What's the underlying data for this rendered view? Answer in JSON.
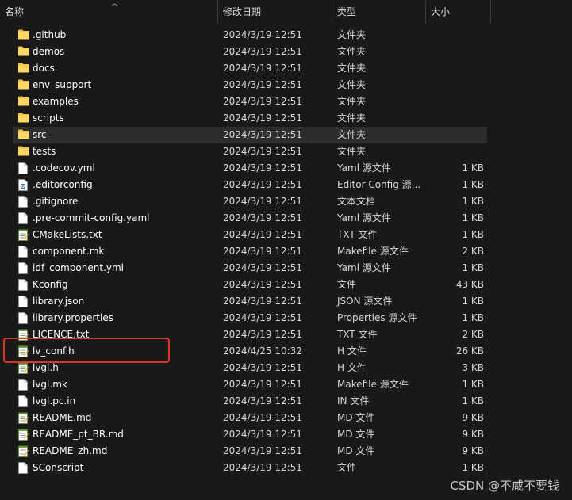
{
  "columns": {
    "name": "名称",
    "date": "修改日期",
    "type": "类型",
    "size": "大小"
  },
  "files": [
    {
      "name": ".github",
      "date": "2024/3/19 12:51",
      "type": "文件夹",
      "size": "",
      "icon": "folder-icon"
    },
    {
      "name": "demos",
      "date": "2024/3/19 12:51",
      "type": "文件夹",
      "size": "",
      "icon": "folder-icon"
    },
    {
      "name": "docs",
      "date": "2024/3/19 12:51",
      "type": "文件夹",
      "size": "",
      "icon": "folder-icon"
    },
    {
      "name": "env_support",
      "date": "2024/3/19 12:51",
      "type": "文件夹",
      "size": "",
      "icon": "folder-icon"
    },
    {
      "name": "examples",
      "date": "2024/3/19 12:51",
      "type": "文件夹",
      "size": "",
      "icon": "folder-icon"
    },
    {
      "name": "scripts",
      "date": "2024/3/19 12:51",
      "type": "文件夹",
      "size": "",
      "icon": "folder-icon"
    },
    {
      "name": "src",
      "date": "2024/3/19 12:51",
      "type": "文件夹",
      "size": "",
      "icon": "folder-icon"
    },
    {
      "name": "tests",
      "date": "2024/3/19 12:51",
      "type": "文件夹",
      "size": "",
      "icon": "folder-icon"
    },
    {
      "name": ".codecov.yml",
      "date": "2024/3/19 12:51",
      "type": "Yaml 源文件",
      "size": "1 KB",
      "icon": "file-icon"
    },
    {
      "name": ".editorconfig",
      "date": "2024/3/19 12:51",
      "type": "Editor Config 源...",
      "size": "1 KB",
      "icon": "config-file-icon"
    },
    {
      "name": ".gitignore",
      "date": "2024/3/19 12:51",
      "type": "文本文档",
      "size": "1 KB",
      "icon": "file-icon"
    },
    {
      "name": ".pre-commit-config.yaml",
      "date": "2024/3/19 12:51",
      "type": "Yaml 源文件",
      "size": "1 KB",
      "icon": "file-icon"
    },
    {
      "name": "CMakeLists.txt",
      "date": "2024/3/19 12:51",
      "type": "TXT 文件",
      "size": "1 KB",
      "icon": "notepad-file-icon"
    },
    {
      "name": "component.mk",
      "date": "2024/3/19 12:51",
      "type": "Makefile 源文件",
      "size": "2 KB",
      "icon": "file-icon"
    },
    {
      "name": "idf_component.yml",
      "date": "2024/3/19 12:51",
      "type": "Yaml 源文件",
      "size": "1 KB",
      "icon": "file-icon"
    },
    {
      "name": "Kconfig",
      "date": "2024/3/19 12:51",
      "type": "文件",
      "size": "43 KB",
      "icon": "file-icon"
    },
    {
      "name": "library.json",
      "date": "2024/3/19 12:51",
      "type": "JSON 源文件",
      "size": "1 KB",
      "icon": "file-icon"
    },
    {
      "name": "library.properties",
      "date": "2024/3/19 12:51",
      "type": "Properties 源文件",
      "size": "1 KB",
      "icon": "file-icon"
    },
    {
      "name": "LICENCE.txt",
      "date": "2024/3/19 12:51",
      "type": "TXT 文件",
      "size": "2 KB",
      "icon": "notepad-file-icon"
    },
    {
      "name": "lv_conf.h",
      "date": "2024/4/25 10:32",
      "type": "H 文件",
      "size": "26 KB",
      "icon": "notepad-file-icon"
    },
    {
      "name": "lvgl.h",
      "date": "2024/3/19 12:51",
      "type": "H 文件",
      "size": "3 KB",
      "icon": "notepad-file-icon"
    },
    {
      "name": "lvgl.mk",
      "date": "2024/3/19 12:51",
      "type": "Makefile 源文件",
      "size": "1 KB",
      "icon": "file-icon"
    },
    {
      "name": "lvgl.pc.in",
      "date": "2024/3/19 12:51",
      "type": "IN 文件",
      "size": "1 KB",
      "icon": "file-icon"
    },
    {
      "name": "README.md",
      "date": "2024/3/19 12:51",
      "type": "MD 文件",
      "size": "9 KB",
      "icon": "notepad-file-icon"
    },
    {
      "name": "README_pt_BR.md",
      "date": "2024/3/19 12:51",
      "type": "MD 文件",
      "size": "9 KB",
      "icon": "notepad-file-icon"
    },
    {
      "name": "README_zh.md",
      "date": "2024/3/19 12:51",
      "type": "MD 文件",
      "size": "9 KB",
      "icon": "notepad-file-icon"
    },
    {
      "name": "SConscript",
      "date": "2024/3/19 12:51",
      "type": "文件",
      "size": "1 KB",
      "icon": "file-icon"
    }
  ],
  "selected_row": "src",
  "highlighted_row": "lv_conf.h",
  "watermark": "CSDN @不咸不要钱",
  "colors": {
    "highlight_border": "#e0322d",
    "folder": "#f4c542",
    "background": "#191919"
  }
}
